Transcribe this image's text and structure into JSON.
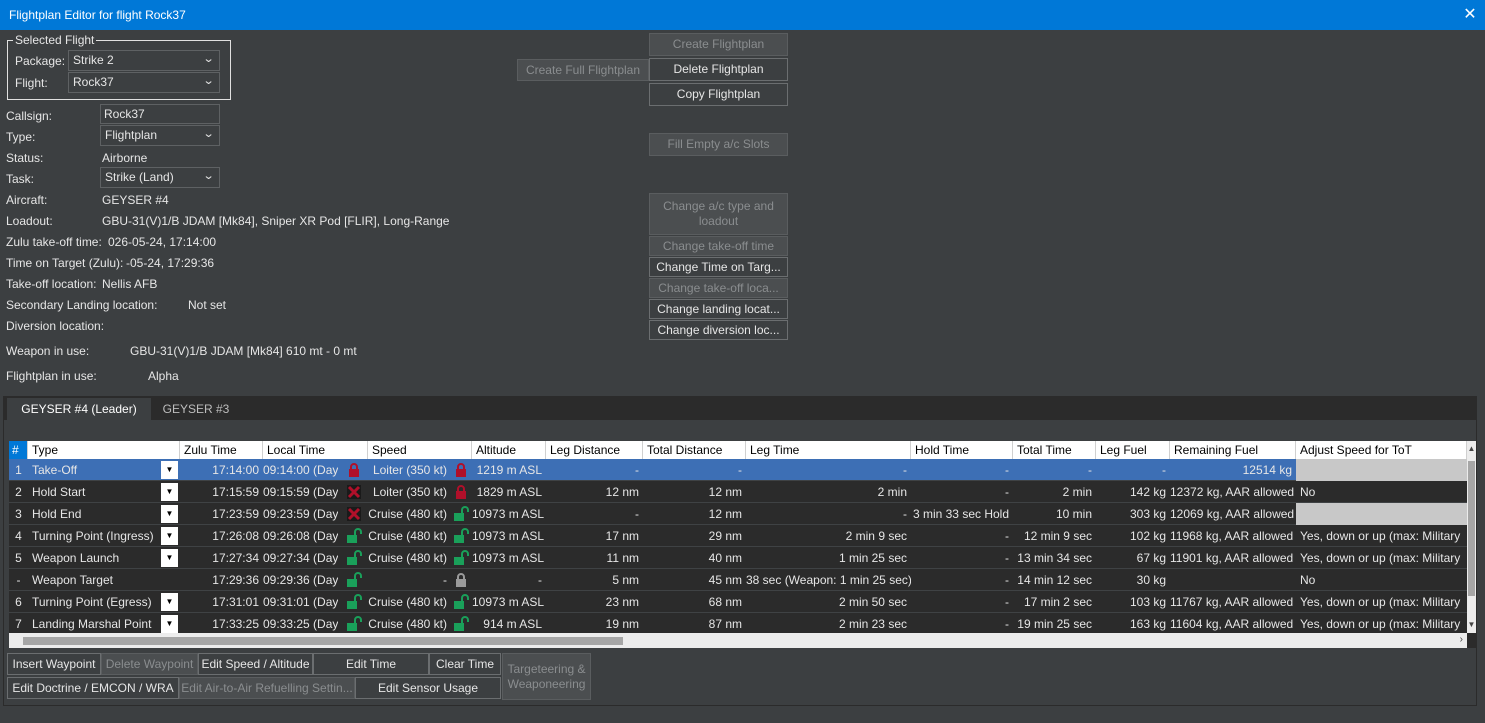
{
  "window": {
    "title": "Flightplan Editor for flight Rock37",
    "close_glyph": "✕"
  },
  "selected_flight": {
    "legend": "Selected Flight",
    "package_label": "Package:",
    "package_value": "Strike 2",
    "flight_label": "Flight:",
    "flight_value": "Rock37"
  },
  "details": {
    "callsign_label": "Callsign:",
    "callsign_value": "Rock37",
    "type_label": "Type:",
    "type_value": "Flightplan",
    "status_label": "Status:",
    "status_value": "Airborne",
    "task_label": "Task:",
    "task_value": "Strike (Land)",
    "aircraft_label": "Aircraft:",
    "aircraft_value": "GEYSER #4",
    "loadout_label": "Loadout:",
    "loadout_value": "GBU-31(V)1/B JDAM [Mk84], Sniper XR Pod [FLIR], Long-Range",
    "takeoff_time_label": "Zulu take-off time:",
    "takeoff_time_value": "026-05-24, 17:14:00",
    "tot_label": "Time on Target (Zulu):",
    "tot_value": "-05-24, 17:29:36",
    "takeoff_loc_label": "Take-off location:",
    "takeoff_loc_value": "Nellis AFB",
    "secondary_label": "Secondary Landing location:",
    "secondary_value": "Not set",
    "diversion_label": "Diversion location:",
    "weapon_label": "Weapon in use:",
    "weapon_value": "GBU-31(V)1/B JDAM [Mk84] 610 mt - 0 mt",
    "fp_label": "Flightplan in use:",
    "fp_value": "Alpha"
  },
  "buttons": {
    "create_full": "Create Full Flightplan",
    "create": "Create Flightplan",
    "delete": "Delete Flightplan",
    "copy": "Copy Flightplan",
    "fill_empty": "Fill Empty a/c Slots",
    "change_type": "Change a/c type and loadout",
    "change_takeoff_time": "Change take-off time",
    "change_tot": "Change Time on Targ...",
    "change_takeoff_loc": "Change take-off loca...",
    "change_landing_loc": "Change landing locat...",
    "change_diversion": "Change diversion loc..."
  },
  "tabs": [
    "GEYSER #4 (Leader)",
    "GEYSER #3"
  ],
  "table": {
    "headers": [
      "#",
      "Type",
      "Zulu Time",
      "Local Time",
      "Speed",
      "Altitude",
      "Leg Distance",
      "Total Distance",
      "Leg Time",
      "Hold Time",
      "Total Time",
      "Leg Fuel",
      "Remaining Fuel",
      "Adjust Speed for ToT"
    ],
    "rows": [
      {
        "num": "1",
        "type": "Take-Off",
        "zulu": "17:14:00",
        "local": "09:14:00 (Day)",
        "speed": "Loiter (350 kt)",
        "alt": "1219 m ASL",
        "legdist": "-",
        "totdist": "-",
        "legtime": "-",
        "hold": "-",
        "tottime": "-",
        "legfuel": "-",
        "remfuel": "12514 kg",
        "adjust": "",
        "icon1": "lock-red-icon",
        "icon2": "lock-red-icon"
      },
      {
        "num": "2",
        "type": "Hold Start",
        "zulu": "17:15:59",
        "local": "09:15:59 (Day)",
        "speed": "Loiter (350 kt)",
        "alt": "1829 m ASL",
        "legdist": "12 nm",
        "totdist": "12 nm",
        "legtime": "2 min",
        "hold": "-",
        "tottime": "2 min",
        "legfuel": "142 kg",
        "remfuel": "12372 kg, AAR allowed",
        "adjust": "No",
        "icon1": "cross-red-icon",
        "icon2": "lock-red-icon"
      },
      {
        "num": "3",
        "type": "Hold End",
        "zulu": "17:23:59",
        "local": "09:23:59 (Day)",
        "speed": "Cruise (480 kt)",
        "alt": "10973 m ASL",
        "legdist": "-",
        "totdist": "12 nm",
        "legtime": "-",
        "hold": "3 min 33 sec Hold",
        "tottime": "10 min",
        "legfuel": "303 kg",
        "remfuel": "12069 kg, AAR allowed",
        "adjust": "",
        "icon1": "cross-red-icon",
        "icon2": "unlock-green-icon"
      },
      {
        "num": "4",
        "type": "Turning Point (Ingress)",
        "zulu": "17:26:08",
        "local": "09:26:08 (Day)",
        "speed": "Cruise (480 kt)",
        "alt": "10973 m ASL",
        "legdist": "17 nm",
        "totdist": "29 nm",
        "legtime": "2 min 9 sec",
        "hold": "-",
        "tottime": "12 min 9 sec",
        "legfuel": "102 kg",
        "remfuel": "11968 kg, AAR allowed",
        "adjust": "Yes, down or up (max: Military",
        "icon1": "unlock-green-icon",
        "icon2": "unlock-green-icon"
      },
      {
        "num": "5",
        "type": "Weapon Launch",
        "zulu": "17:27:34",
        "local": "09:27:34 (Day)",
        "speed": "Cruise (480 kt)",
        "alt": "10973 m ASL",
        "legdist": "11 nm",
        "totdist": "40 nm",
        "legtime": "1 min 25 sec",
        "hold": "-",
        "tottime": "13 min 34 sec",
        "legfuel": "67 kg",
        "remfuel": "11901 kg, AAR allowed",
        "adjust": "Yes, down or up (max: Military",
        "icon1": "unlock-green-icon",
        "icon2": "unlock-green-icon"
      },
      {
        "num": "-",
        "type": "Weapon Target",
        "zulu": "17:29:36",
        "local": "09:29:36 (Day)",
        "speed": "-",
        "alt": "-",
        "legdist": "5 nm",
        "totdist": "45 nm",
        "legtime": "38 sec (Weapon: 1 min 25 sec)",
        "hold": "-",
        "tottime": "14 min 12 sec",
        "legfuel": "30 kg",
        "remfuel": "",
        "adjust": "No",
        "icon1": "unlock-green-icon",
        "icon2": "lock-grey-icon",
        "no_dropdown": true
      },
      {
        "num": "6",
        "type": "Turning Point (Egress)",
        "zulu": "17:31:01",
        "local": "09:31:01 (Day)",
        "speed": "Cruise (480 kt)",
        "alt": "10973 m ASL",
        "legdist": "23 nm",
        "totdist": "68 nm",
        "legtime": "2 min 50 sec",
        "hold": "-",
        "tottime": "17 min 2 sec",
        "legfuel": "103 kg",
        "remfuel": "11767 kg, AAR allowed",
        "adjust": "Yes, down or up (max: Military",
        "icon1": "unlock-green-icon",
        "icon2": "unlock-green-icon"
      },
      {
        "num": "7",
        "type": "Landing Marshal Point",
        "zulu": "17:33:25",
        "local": "09:33:25 (Day)",
        "speed": "Cruise (480 kt)",
        "alt": "914 m ASL",
        "legdist": "19 nm",
        "totdist": "87 nm",
        "legtime": "2 min 23 sec",
        "hold": "-",
        "tottime": "19 min 25 sec",
        "legfuel": "163 kg",
        "remfuel": "11604 kg, AAR allowed",
        "adjust": "Yes, down or up (max: Military",
        "icon1": "unlock-green-icon",
        "icon2": "unlock-green-icon"
      }
    ]
  },
  "bottom_buttons": {
    "insert": "Insert Waypoint",
    "delete": "Delete Waypoint",
    "edit_speed": "Edit Speed / Altitude",
    "edit_time": "Edit Time",
    "clear_time": "Clear Time",
    "targeteering": "Targeteering & Weaponeering",
    "edit_doctrine": "Edit Doctrine / EMCON / WRA",
    "edit_aar": "Edit Air-to-Air Refuelling Settin...",
    "edit_sensor": "Edit Sensor Usage"
  },
  "colors": {
    "titlebar": "#0078d7",
    "selected_row": "#3d6fb5",
    "lock_red": "#b0102a",
    "unlock_green": "#1aa05a"
  }
}
